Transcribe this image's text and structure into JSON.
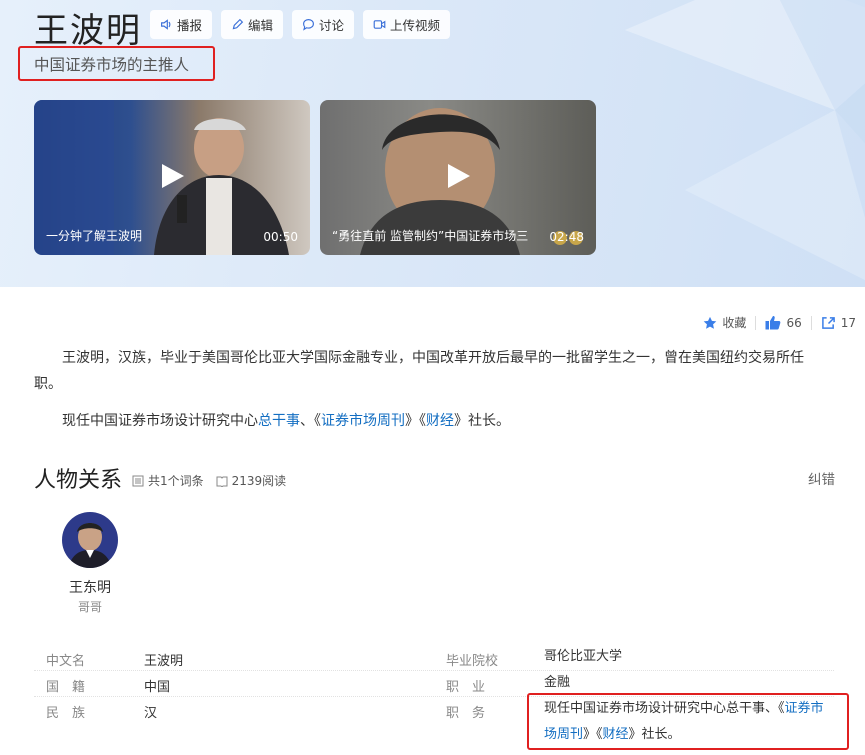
{
  "header": {
    "title": "王波明",
    "subtitle": "中国证券市场的主推人",
    "actions": [
      {
        "label": "播报",
        "icon": "sound-icon"
      },
      {
        "label": "编辑",
        "icon": "pencil-icon"
      },
      {
        "label": "讨论",
        "icon": "chat-icon"
      },
      {
        "label": "上传视频",
        "icon": "video-camera-icon"
      }
    ]
  },
  "videos": [
    {
      "caption": "一分钟了解王波明",
      "duration": "00:50"
    },
    {
      "caption": "“勇往直前 监管制约”中国证券市场三",
      "duration": "02:48"
    }
  ],
  "stats": {
    "favorite_label": "收藏",
    "likes": "66",
    "shares": "17"
  },
  "intro": {
    "p1": "王波明，汉族，毕业于美国哥伦比亚大学国际金融专业，中国改革开放后最早的一批留学生之一，曾在美国纽约交易所任职。",
    "p2_prefix": "现任中国证券市场设计研究中心",
    "p2_link1": "总干事",
    "p2_mid1": "、《",
    "p2_link2": "证券市场周刊",
    "p2_mid2": "》《",
    "p2_link3": "财经",
    "p2_suffix": "》社长。"
  },
  "relations": {
    "title": "人物关系",
    "entries": "共1个词条",
    "reads": "2139阅读",
    "correct": "纠错",
    "person": {
      "name": "王东明",
      "relation": "哥哥"
    }
  },
  "info_table": {
    "rows": [
      {
        "k1": "中文名",
        "v1": "王波明",
        "k2": "毕业院校",
        "v2": "哥伦比亚大学"
      },
      {
        "k1": "国　籍",
        "v1": "中国",
        "k2": "职　业",
        "v2": "金融"
      },
      {
        "k1": "民　族",
        "v1": "汉",
        "k2": "职　务"
      }
    ],
    "duty": {
      "prefix": "现任中国证券市场设计研究中心总干事、《",
      "link1": "证券市场周刊",
      "mid": "》《",
      "link2": "财经",
      "suffix": "》社长。"
    }
  },
  "colors": {
    "link": "#136ec2",
    "highlight": "#e02020",
    "like": "#3a7ee8"
  }
}
